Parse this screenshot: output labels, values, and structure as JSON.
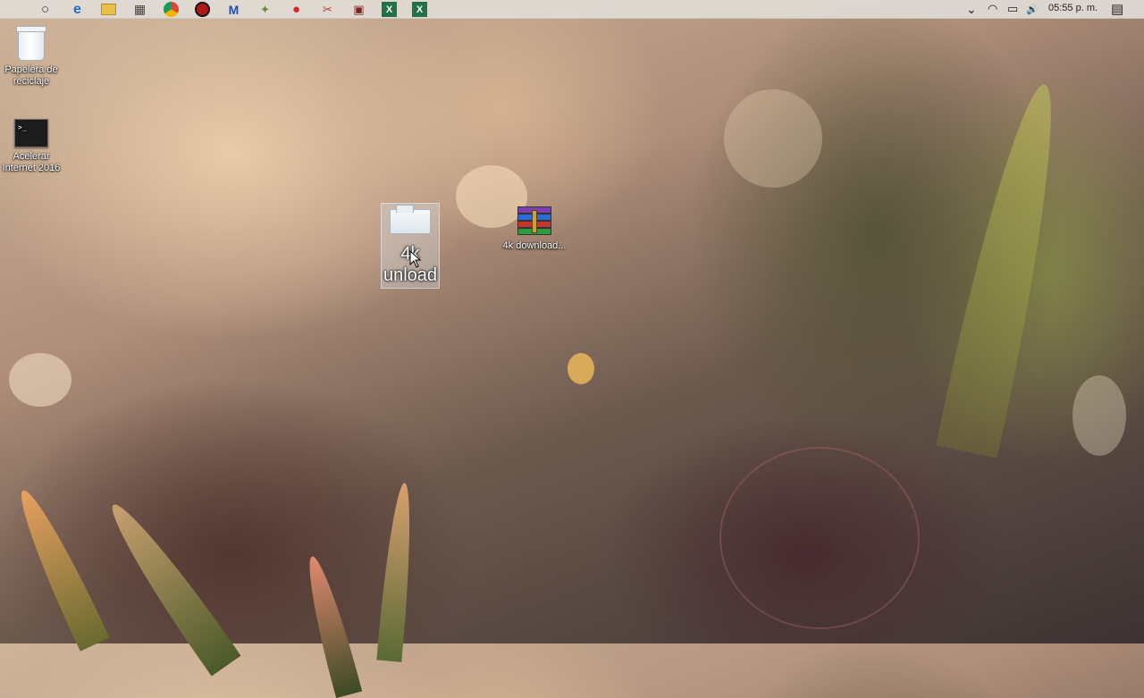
{
  "taskbar": {
    "pinned_icons": [
      {
        "name": "apple-icon",
        "glyph": ""
      },
      {
        "name": "cortana-icon",
        "glyph": "○"
      },
      {
        "name": "edge-icon",
        "glyph": "e"
      },
      {
        "name": "file-explorer-icon",
        "glyph": "▭"
      },
      {
        "name": "store-icon",
        "glyph": "▦"
      },
      {
        "name": "chrome-icon",
        "glyph": "◉"
      },
      {
        "name": "record-icon",
        "glyph": "●"
      },
      {
        "name": "malwarebytes-icon",
        "glyph": "M"
      },
      {
        "name": "app-icon-green",
        "glyph": "✦"
      },
      {
        "name": "red-circle-icon",
        "glyph": "●"
      },
      {
        "name": "tool-icon",
        "glyph": "✂"
      },
      {
        "name": "camera-app-icon",
        "glyph": "▣"
      },
      {
        "name": "excel-icon",
        "glyph": "X"
      },
      {
        "name": "excel-icon-2",
        "glyph": "X"
      }
    ],
    "tray": {
      "chevron": "⌄",
      "wifi": "◠",
      "battery": "▭",
      "volume": "🔊",
      "time": "05:55 p. m.",
      "notification": "▤"
    }
  },
  "desktop": {
    "recycle_bin_label": "Papelera de reciclaje",
    "acelerar_label": "Acelerar Internet 2016",
    "cmd_prompt": ">_",
    "dragging_label": "4k\nunload",
    "rar_label": "4k download..."
  },
  "colors": {
    "taskbar_bg": "#e1dcd7",
    "accent_red": "#d62828",
    "excel_green": "#217346"
  }
}
